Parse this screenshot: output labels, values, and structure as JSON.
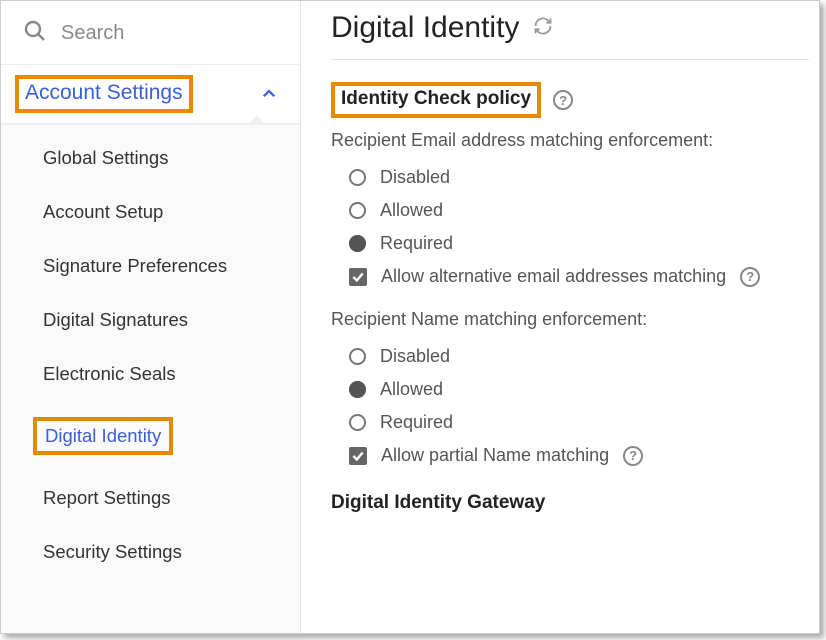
{
  "sidebar": {
    "search_placeholder": "Search",
    "section_label": "Account Settings",
    "items": [
      {
        "label": "Global Settings",
        "active": false
      },
      {
        "label": "Account Setup",
        "active": false
      },
      {
        "label": "Signature Preferences",
        "active": false
      },
      {
        "label": "Digital Signatures",
        "active": false
      },
      {
        "label": "Electronic Seals",
        "active": false
      },
      {
        "label": "Digital Identity",
        "active": true
      },
      {
        "label": "Report Settings",
        "active": false
      },
      {
        "label": "Security Settings",
        "active": false
      }
    ]
  },
  "main": {
    "page_title": "Digital Identity",
    "policy_title": "Identity Check policy",
    "email_group_label": "Recipient Email address matching enforcement:",
    "email_options": {
      "disabled": "Disabled",
      "allowed": "Allowed",
      "required": "Required",
      "selected": "required"
    },
    "email_alt_checkbox_label": "Allow alternative email addresses matching",
    "email_alt_checked": true,
    "name_group_label": "Recipient Name matching enforcement:",
    "name_options": {
      "disabled": "Disabled",
      "allowed": "Allowed",
      "required": "Required",
      "selected": "allowed"
    },
    "name_partial_checkbox_label": "Allow partial Name matching",
    "name_partial_checked": true,
    "gateway_title": "Digital Identity Gateway"
  }
}
